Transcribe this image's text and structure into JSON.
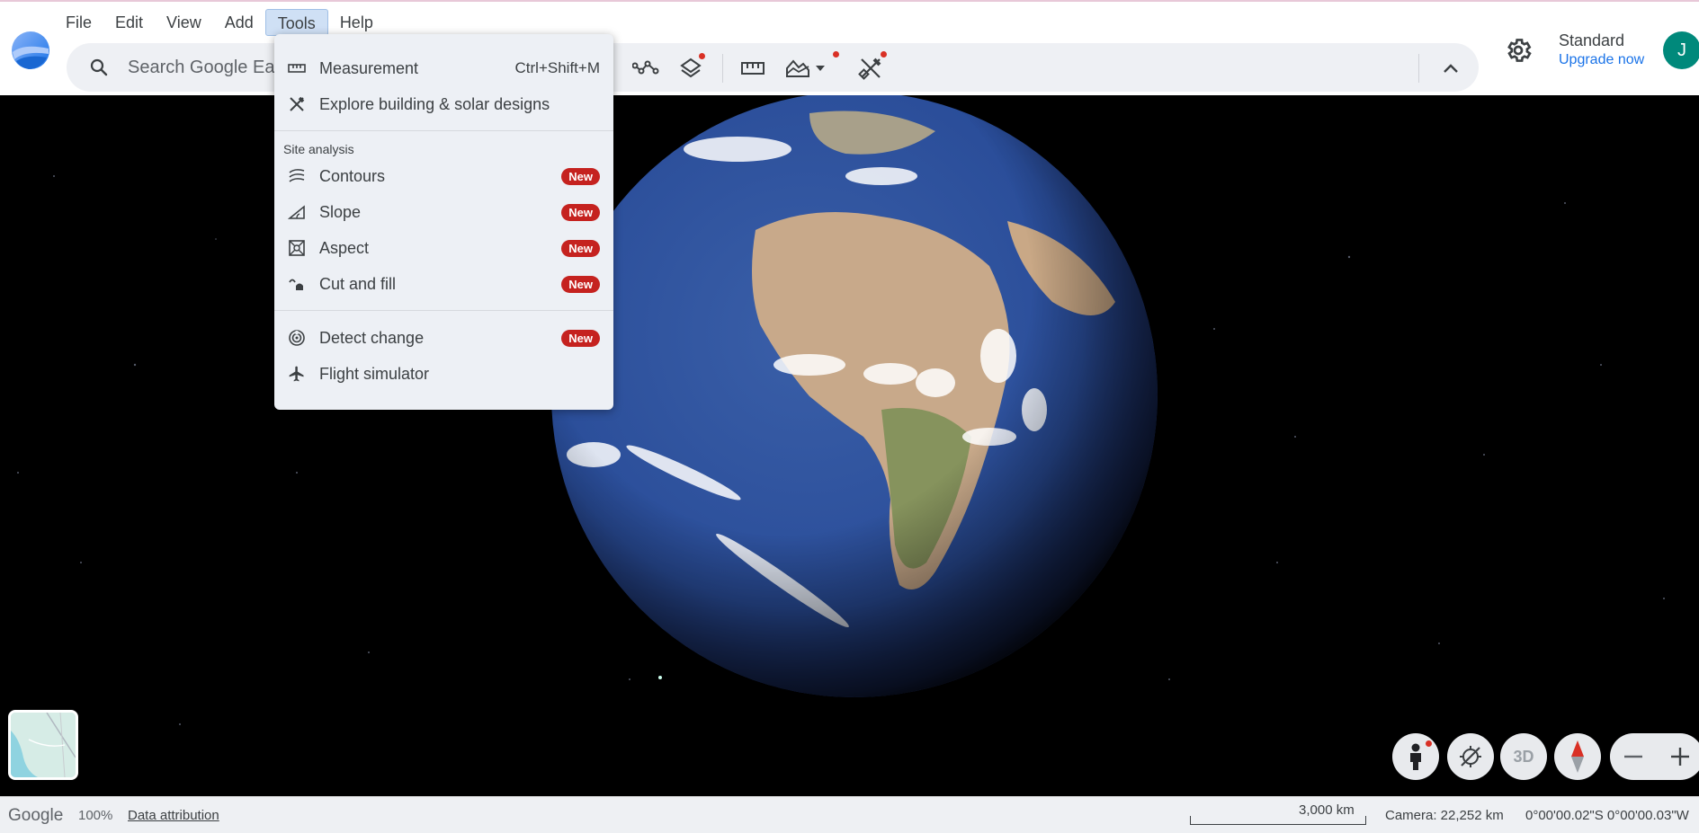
{
  "menu": {
    "items": [
      "File",
      "Edit",
      "View",
      "Add",
      "Tools",
      "Help"
    ]
  },
  "search": {
    "placeholder": "Search Google Ea"
  },
  "account": {
    "plan": "Standard",
    "upgrade": "Upgrade now",
    "avatar_initial": "J"
  },
  "tools_menu": {
    "measurement": {
      "label": "Measurement",
      "shortcut": "Ctrl+Shift+M"
    },
    "explore": {
      "label": "Explore building & solar designs"
    },
    "section_site_analysis": "Site analysis",
    "contours": {
      "label": "Contours",
      "badge": "New"
    },
    "slope": {
      "label": "Slope",
      "badge": "New"
    },
    "aspect": {
      "label": "Aspect",
      "badge": "New"
    },
    "cut_fill": {
      "label": "Cut and fill",
      "badge": "New"
    },
    "detect_change": {
      "label": "Detect change",
      "badge": "New"
    },
    "flight_sim": {
      "label": "Flight simulator"
    }
  },
  "controls": {
    "three_d": "3D"
  },
  "status": {
    "brand": "Google",
    "zoom": "100%",
    "attribution": "Data attribution",
    "scale": "3,000 km",
    "camera": "Camera: 22,252 km",
    "coords": "0°00'00.02\"S 0°00'00.03\"W"
  },
  "colors": {
    "accent": "#1a73e8",
    "badge": "#c5221f",
    "avatar": "#00897b",
    "menu_active": "#cfe0f5"
  }
}
